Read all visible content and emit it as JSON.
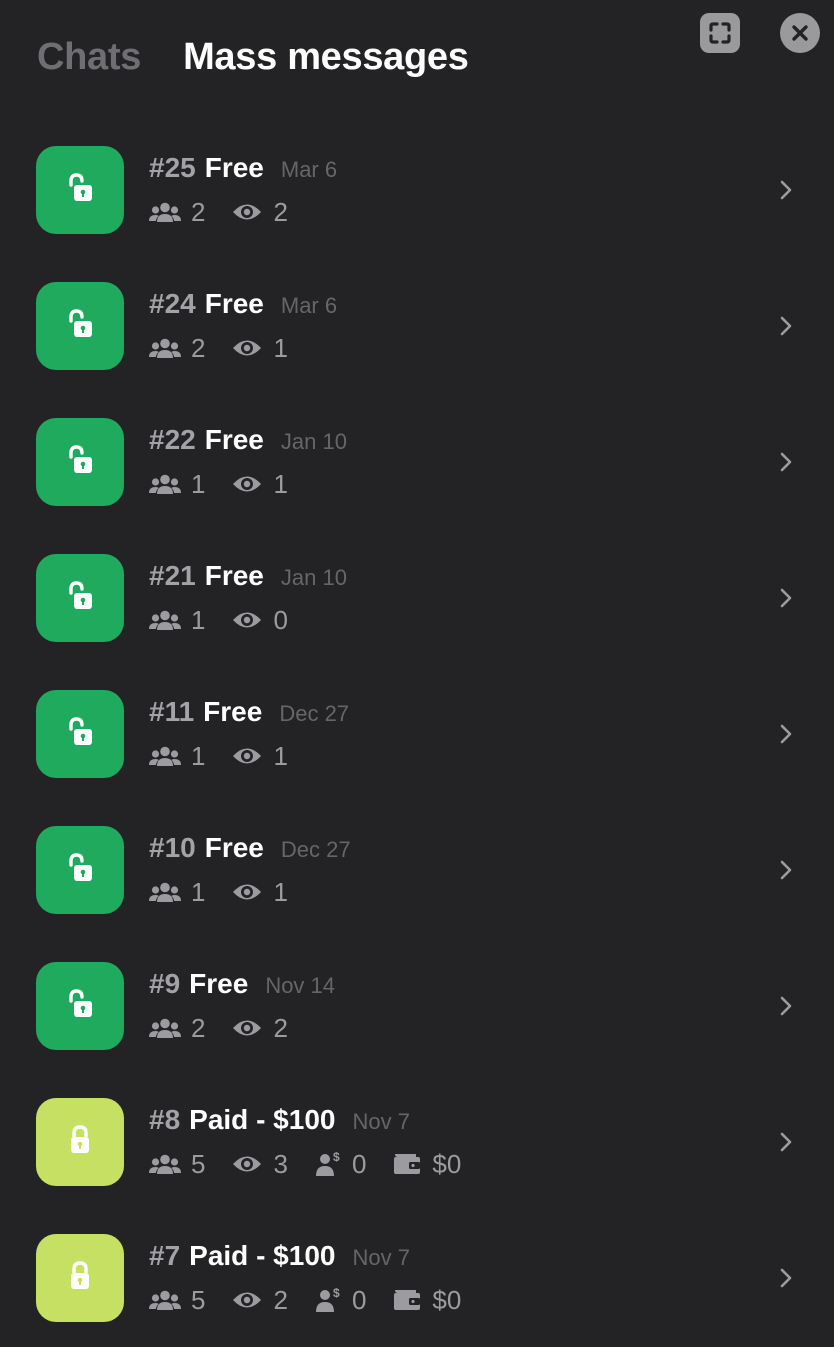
{
  "tabs": {
    "chats": "Chats",
    "mass_messages": "Mass messages"
  },
  "colors": {
    "free": "#1faa5e",
    "paid": "#c5e062",
    "background": "#232325"
  },
  "icons": {
    "resize": "resize-icon",
    "close": "close-icon",
    "free_lock": "unlocked-lock-icon",
    "paid_lock": "locked-lock-icon",
    "recipients": "users-icon",
    "views": "eye-icon",
    "buyers": "dollar-user-icon",
    "revenue": "wallet-icon",
    "chevron": "chevron-right-icon"
  },
  "messages": [
    {
      "num": "#25",
      "kind": "Free",
      "date": "Mar 6",
      "type": "free",
      "recipients": "2",
      "views": "2"
    },
    {
      "num": "#24",
      "kind": "Free",
      "date": "Mar 6",
      "type": "free",
      "recipients": "2",
      "views": "1"
    },
    {
      "num": "#22",
      "kind": "Free",
      "date": "Jan 10",
      "type": "free",
      "recipients": "1",
      "views": "1"
    },
    {
      "num": "#21",
      "kind": "Free",
      "date": "Jan 10",
      "type": "free",
      "recipients": "1",
      "views": "0"
    },
    {
      "num": "#11",
      "kind": "Free",
      "date": "Dec 27",
      "type": "free",
      "recipients": "1",
      "views": "1"
    },
    {
      "num": "#10",
      "kind": "Free",
      "date": "Dec 27",
      "type": "free",
      "recipients": "1",
      "views": "1"
    },
    {
      "num": "#9",
      "kind": "Free",
      "date": "Nov 14",
      "type": "free",
      "recipients": "2",
      "views": "2"
    },
    {
      "num": "#8",
      "kind": "Paid - $100",
      "date": "Nov 7",
      "type": "paid",
      "recipients": "5",
      "views": "3",
      "buyers": "0",
      "revenue": "$0"
    },
    {
      "num": "#7",
      "kind": "Paid - $100",
      "date": "Nov 7",
      "type": "paid",
      "recipients": "5",
      "views": "2",
      "buyers": "0",
      "revenue": "$0"
    }
  ]
}
